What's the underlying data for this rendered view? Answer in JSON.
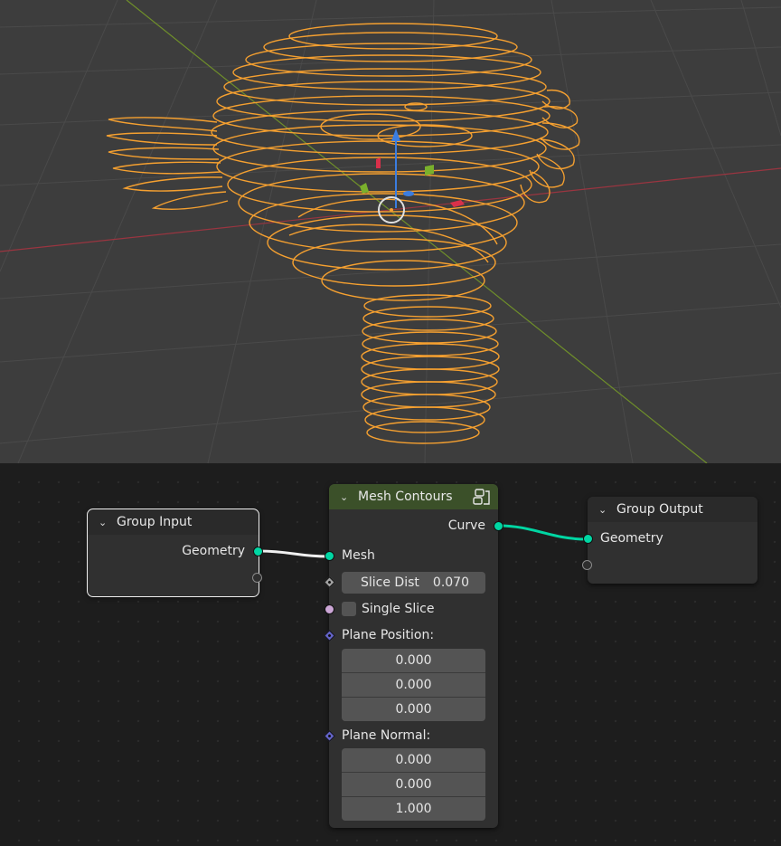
{
  "nodes": {
    "group_input": {
      "title": "Group Input",
      "outputs": [
        "Geometry"
      ]
    },
    "mesh_contours": {
      "title": "Mesh Contours",
      "output": "Curve",
      "input_mesh": "Mesh",
      "slice_dist": {
        "label": "Slice Dist",
        "value": "0.070"
      },
      "single_slice": "Single Slice",
      "plane_position": {
        "label": "Plane Position:",
        "values": [
          "0.000",
          "0.000",
          "0.000"
        ]
      },
      "plane_normal": {
        "label": "Plane Normal:",
        "values": [
          "0.000",
          "0.000",
          "1.000"
        ]
      }
    },
    "group_output": {
      "title": "Group Output",
      "inputs": [
        "Geometry"
      ]
    }
  },
  "icons": {
    "collapse": "chevron-down-icon",
    "node_group": "node-group-icon",
    "gizmo": "3d-cursor-icon"
  },
  "colors": {
    "viewport_bg": "#3d3d3d",
    "editor_bg": "#1d1d1d",
    "wire_curve": "#f5a030",
    "geometry_socket": "#00d6a3",
    "header_green": "#3b5029",
    "x_axis": "#9a3540",
    "y_axis": "#6f8f2a"
  }
}
